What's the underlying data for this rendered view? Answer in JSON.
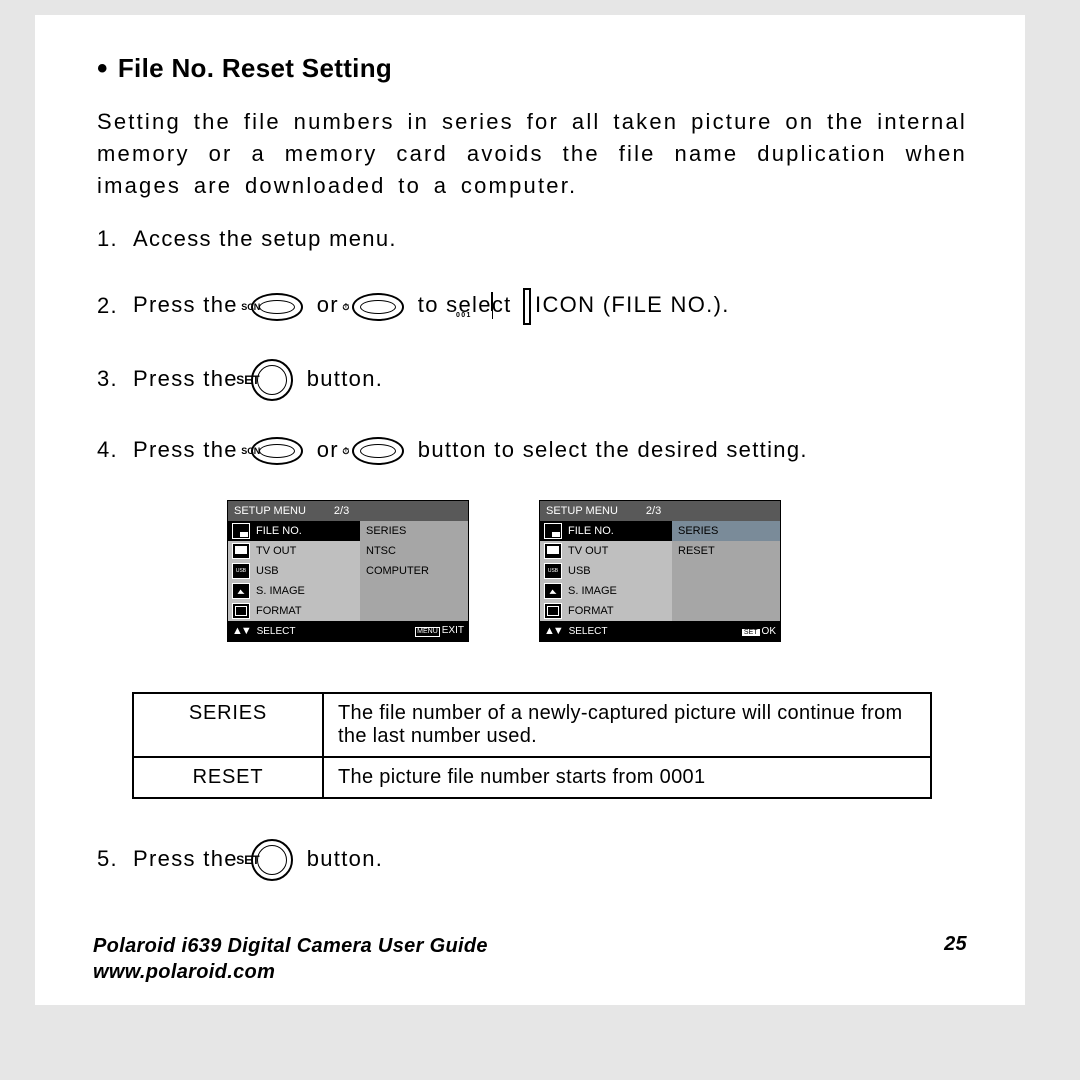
{
  "title": "File No. Reset Setting",
  "intro": "Setting the file numbers in series for all taken picture on the internal memory or a memory card avoids the file name duplication when images are downloaded to a computer.",
  "steps": {
    "s1": "Access the setup menu.",
    "s2a": "Press the",
    "s2b": "or",
    "s2c": "to select",
    "s2d": "ICON (FILE NO.).",
    "s3a": "Press the",
    "s3b": "button.",
    "s4a": "Press the",
    "s4b": "or",
    "s4c": "button to select the desired setting.",
    "s5a": "Press the",
    "s5b": "button."
  },
  "button_labels": {
    "scn": "SCN",
    "timer": "",
    "set": "SET"
  },
  "screen": {
    "title": "SETUP MENU",
    "page": "2/3",
    "items": [
      "FILE NO.",
      "TV OUT",
      "USB",
      "S. IMAGE",
      "FORMAT"
    ],
    "left_vals": [
      "SERIES",
      "NTSC",
      "COMPUTER"
    ],
    "right_vals": [
      "SERIES",
      "RESET"
    ],
    "footer_select": "SELECT",
    "footer_exit_label": "MENU",
    "footer_exit": "EXIT",
    "footer_ok_label": "SET",
    "footer_ok": "OK"
  },
  "definitions": {
    "h1": "SERIES",
    "d1": "The file number of a newly-captured picture will continue from the last number used.",
    "h2": "RESET",
    "d2": "The picture file number starts from 0001"
  },
  "footer": {
    "guide": "Polaroid i639 Digital Camera User Guide",
    "url": "www.polaroid.com",
    "page": "25"
  }
}
